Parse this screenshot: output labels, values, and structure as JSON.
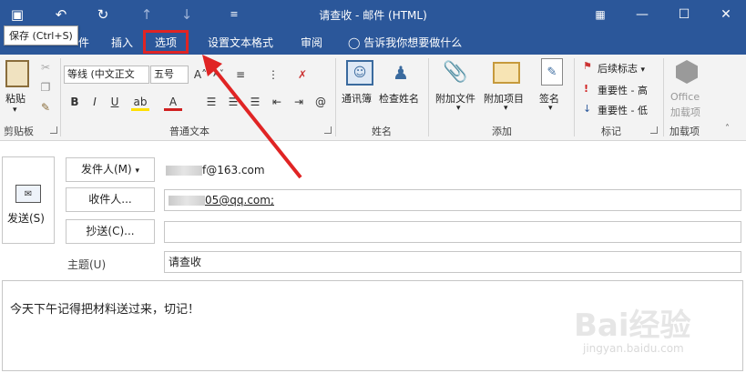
{
  "window": {
    "title": "请查收 - 邮件 (HTML)",
    "tooltip": "保存 (Ctrl+S)"
  },
  "tabs": [
    {
      "label": "件"
    },
    {
      "label": "插入"
    },
    {
      "label": "选项"
    },
    {
      "label": "设置文本格式"
    },
    {
      "label": "审阅"
    }
  ],
  "tell_me": "告诉我你想要做什么",
  "ribbon": {
    "clipboard": {
      "paste": "粘贴",
      "group": "剪贴板"
    },
    "basic_text": {
      "font": "等线 (中文正文",
      "size": "五号",
      "group": "普通文本"
    },
    "names": {
      "address_book": "通讯簿",
      "check_names": "检查姓名",
      "group": "姓名"
    },
    "include": {
      "attach_file": "附加文件",
      "attach_item": "附加项目",
      "signature": "签名",
      "group": "添加"
    },
    "tags": {
      "follow_up": "后续标志",
      "high": "重要性 - 高",
      "low": "重要性 - 低",
      "group": "标记"
    },
    "addins": {
      "office": "Office",
      "office2": "加载项",
      "group": "加载项"
    }
  },
  "mail": {
    "send": "发送(S)",
    "from_label": "发件人(M)",
    "from_value": "f@163.com",
    "to_label": "收件人...",
    "to_value": "05@qq.com;",
    "cc_label": "抄送(C)...",
    "cc_value": "",
    "subject_label": "主题(U)",
    "subject_value": "请查收",
    "body": "今天下午记得把材料送过来，切记！"
  },
  "watermark": {
    "main": "Bai经验",
    "sub": "jingyan.baidu.com"
  },
  "colors": {
    "brand": "#2b579a",
    "highlight": "#e02424"
  }
}
